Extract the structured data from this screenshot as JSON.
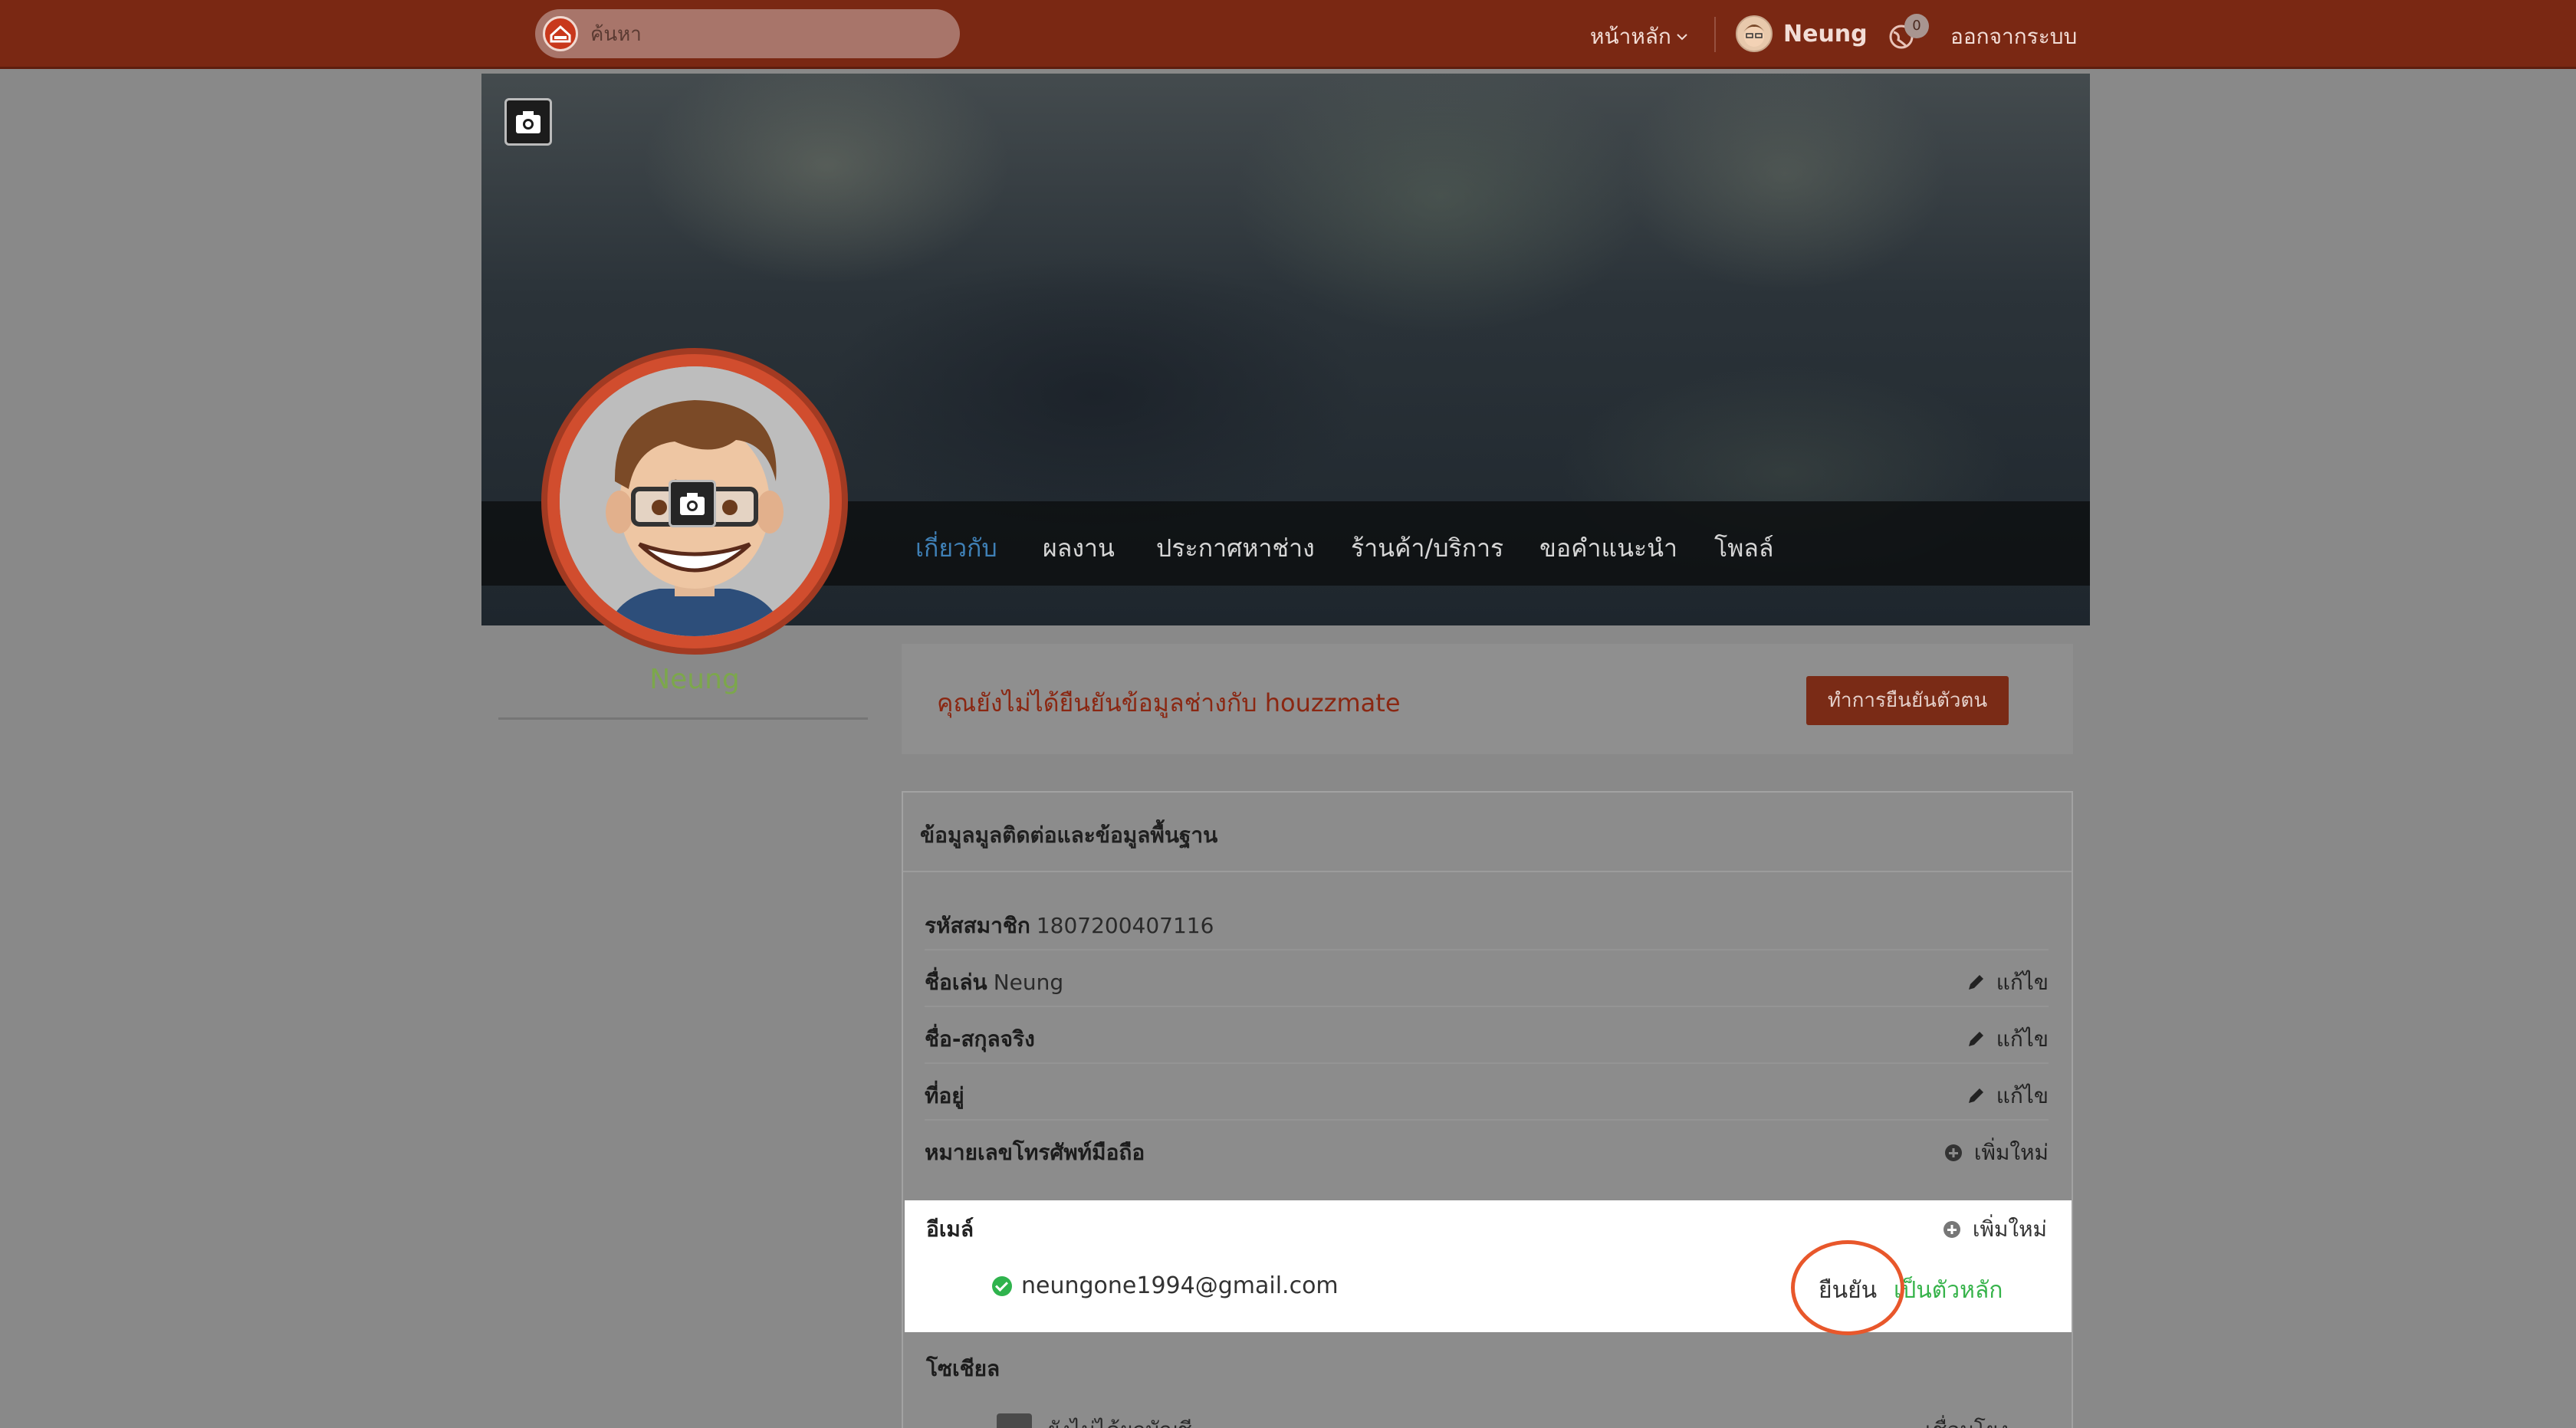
{
  "navbar": {
    "search_placeholder": "ค้นหา",
    "home_label": "หน้าหลัก",
    "user_name": "Neung",
    "notification_count": "0",
    "logout_label": "ออกจากระบบ"
  },
  "profile": {
    "name": "Neung",
    "tabs": [
      {
        "label": "เกี่ยวกับ"
      },
      {
        "label": "ผลงาน"
      },
      {
        "label": "ประกาศหาช่าง"
      },
      {
        "label": "ร้านค้า/บริการ"
      },
      {
        "label": "ขอคำแนะนำ"
      },
      {
        "label": "โพลล์"
      }
    ]
  },
  "verify": {
    "message": "คุณยังไม่ได้ยืนยันข้อมูลช่างกับ houzzmate",
    "button": "ทำการยืนยันตัวตน"
  },
  "info": {
    "title": "ข้อมูลมูลติดต่อและข้อมูลพื้นฐาน",
    "member_id_label": "รหัสสมาชิก",
    "member_id": "1807200407116",
    "nickname_label": "ชื่อเล่น",
    "nickname": "Neung",
    "fullname_label": "ชื่อ-สกุลจริง",
    "address_label": "ที่อยู่",
    "phone_label": "หมายเลขโทรศัพท์มือถือ",
    "edit_label": "แก้ไข",
    "add_label": "เพิ่มใหม่",
    "email_label": "อีเมล์",
    "email": "neungone1994@gmail.com",
    "verify_email": "ยืนยัน",
    "set_primary": "เป็นตัวหลัก",
    "social_label": "โซเชียล",
    "social_status": "ยังไม่ได้ผูกบัญชี",
    "social_connect": "เชื่อมโยง"
  },
  "colors": {
    "navbar": "#7a2813",
    "accent": "#d14d2e",
    "active_tab": "#3f80b6",
    "success": "#36b34a",
    "annotation": "#e8572b"
  }
}
